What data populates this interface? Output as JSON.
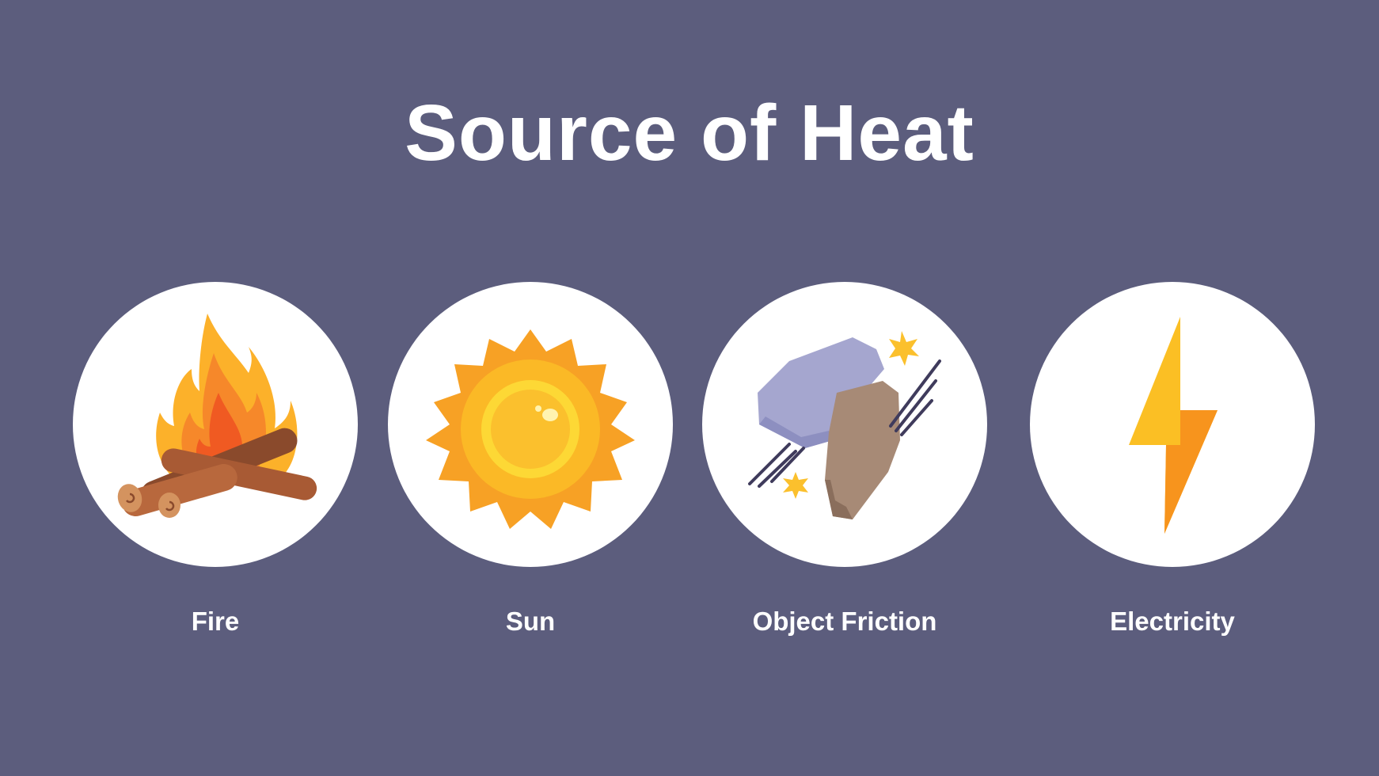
{
  "title": "Source of Heat",
  "colors": {
    "background": "#5c5d7d",
    "circle": "#ffffff",
    "text": "#ffffff"
  },
  "items": [
    {
      "label": "Fire",
      "icon": "campfire-icon"
    },
    {
      "label": "Sun",
      "icon": "sun-icon"
    },
    {
      "label": "Object Friction",
      "icon": "rocks-friction-icon"
    },
    {
      "label": "Electricity",
      "icon": "lightning-bolt-icon"
    }
  ]
}
